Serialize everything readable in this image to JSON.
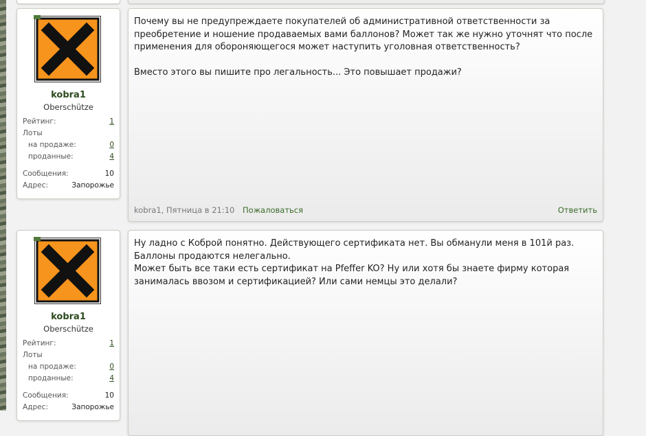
{
  "posts": [
    {
      "user": {
        "name": "kobra1",
        "title": "Oberschütze",
        "rating_label": "Рейтинг:",
        "rating_value": "1",
        "lots_label": "Лоты",
        "for_sale_label": "на продаже:",
        "for_sale_value": "0",
        "sold_label": "проданные:",
        "sold_value": "4",
        "messages_label": "Сообщения:",
        "messages_value": "10",
        "address_label": "Адрес:",
        "address_value": "Запорожье"
      },
      "text": "Почему вы не предупреждаете покупателей об административной ответственности за преобретение и ношение продаваемых вами баллонов? Может так же нужно уточнят что после применения для обороняющегося может наступить уголовная ответственность?\n\nВместо этого вы пишите про легальность... Это повышает продажи?",
      "meta": "kobra1, Пятница в 21:10",
      "report_label": "Пожаловаться",
      "reply_label": "Ответить"
    },
    {
      "user": {
        "name": "kobra1",
        "title": "Oberschütze",
        "rating_label": "Рейтинг:",
        "rating_value": "1",
        "lots_label": "Лоты",
        "for_sale_label": "на продаже:",
        "for_sale_value": "0",
        "sold_label": "проданные:",
        "sold_value": "4",
        "messages_label": "Сообщения:",
        "messages_value": "10",
        "address_label": "Адрес:",
        "address_value": "Запорожье"
      },
      "text": "Ну ладно с Коброй понятно. Действующего сертификата нет. Вы обманули меня в 101й раз. Баллоны продаются нелегально.\nМожет быть все таки есть сертификат на Pfeffer KO? Ну или хотя бы знаете фирму которая занималась ввозом и сертификацией? Или сами немцы это делали?"
    }
  ],
  "colors": {
    "accent": "#3b6b2a",
    "username": "#2c4a1e",
    "avatar_orange": "#f7941d",
    "avatar_cross": "#111111"
  },
  "icons": {
    "avatar": "hazard-x-icon"
  }
}
